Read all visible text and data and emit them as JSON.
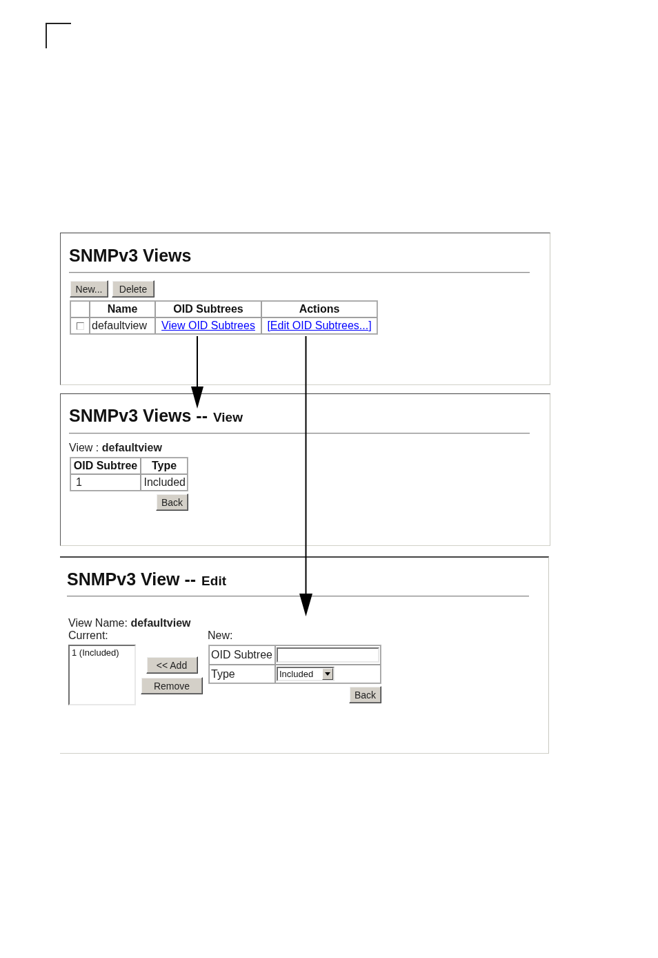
{
  "views_panel": {
    "title": "SNMPv3 Views",
    "buttons": [
      "New...",
      "Delete"
    ],
    "table": {
      "columns": [
        "Name",
        "OID Subtrees",
        "Actions"
      ],
      "rows": [
        {
          "checked": false,
          "name": "defaultview",
          "view_link": "View OID Subtrees",
          "edit_link": "[Edit OID Subtrees...]"
        }
      ]
    }
  },
  "view_panel": {
    "title": "SNMPv3 Views --",
    "title_suffix": "View",
    "view_line": "View : **defaultview**",
    "table": {
      "columns": [
        "OID Subtree",
        "Type"
      ],
      "rows": [
        {
          "oid": "1",
          "type": "Included"
        }
      ]
    },
    "back_button": "Back"
  },
  "edit_panel": {
    "title": "SNMPv3 View --",
    "title_suffix": "Edit",
    "view_line": "View Name: **defaultview**",
    "current_label": "Current:",
    "current_items": [
      "1 (Included)"
    ],
    "add_button": "<< Add",
    "remove_button": "Remove",
    "new_label": "New:",
    "fields": [
      {
        "kind": "text",
        "label": "OID Subtree"
      },
      {
        "kind": "select",
        "label": "Type",
        "value": "Included"
      }
    ],
    "back_button": "Back"
  }
}
